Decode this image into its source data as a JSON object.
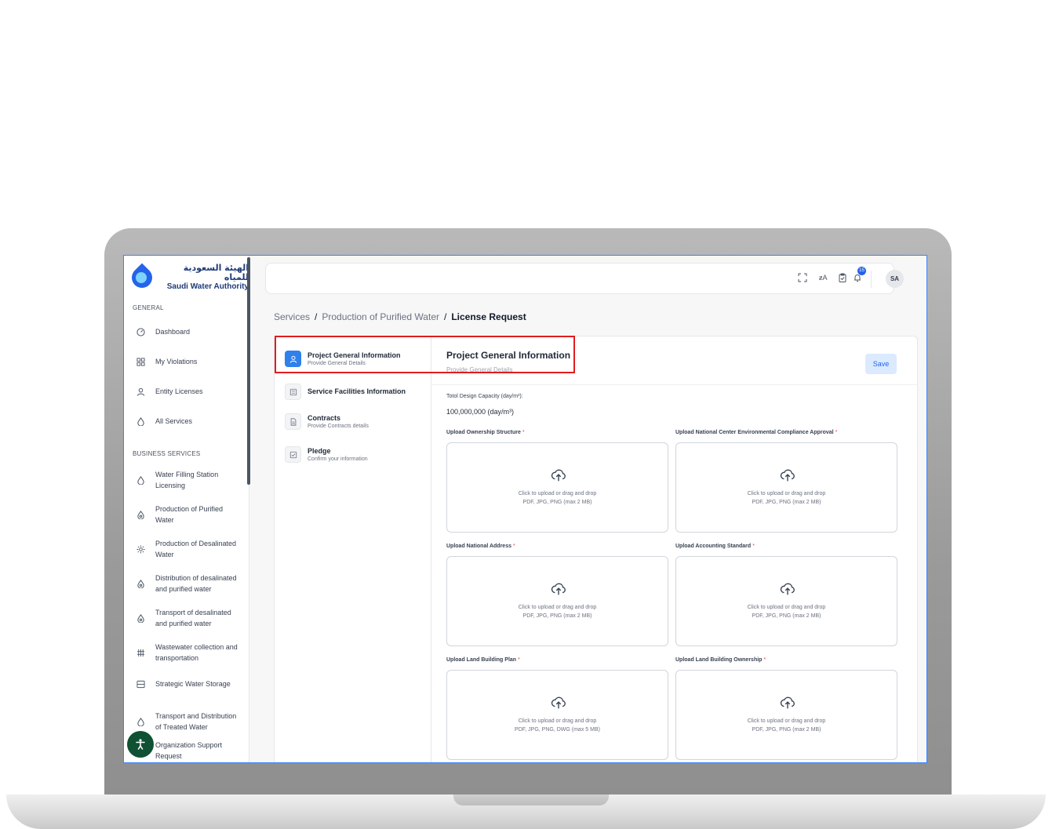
{
  "brand": {
    "arabic": "الهيئة السعودية للمياه",
    "english": "Saudi Water Authority"
  },
  "sidebar": {
    "general_heading": "GENERAL",
    "general_items": [
      {
        "label": "Dashboard",
        "icon": "dashboard-icon"
      },
      {
        "label": "My Violations",
        "icon": "grid-icon"
      },
      {
        "label": "Entity Licenses",
        "icon": "user-icon"
      },
      {
        "label": "All Services",
        "icon": "drop-icon"
      }
    ],
    "business_heading": "BUSINESS SERVICES",
    "business_items": [
      {
        "label": "Water Filling Station Licensing",
        "icon": "drop-icon"
      },
      {
        "label": "Production of Purified Water",
        "icon": "drop-icon"
      },
      {
        "label": "Production of Desalinated Water",
        "icon": "sun-icon"
      },
      {
        "label": "Distribution of desalinated and purified water",
        "icon": "drop-icon"
      },
      {
        "label": "Transport of desalinated and purified water",
        "icon": "drop-icon"
      },
      {
        "label": "Wastewater collection and transportation",
        "icon": "pipes-icon"
      },
      {
        "label": "Strategic Water Storage",
        "icon": "storage-icon"
      },
      {
        "label": "Transport and Distribution of Treated Water",
        "icon": "drop-icon"
      },
      {
        "label": "Organization Support Request",
        "icon": "support-icon"
      }
    ]
  },
  "topbar": {
    "avatar": "SA",
    "notification_count": "15"
  },
  "breadcrumb": {
    "item1": "Services",
    "item2": "Production of Purified Water",
    "current": "License Request",
    "separator": "/"
  },
  "steps": [
    {
      "title": "Project General Information",
      "subtitle": "Provide General Details"
    },
    {
      "title": "Service Facilities Information",
      "subtitle": ""
    },
    {
      "title": "Contracts",
      "subtitle": "Provide Contracts details"
    },
    {
      "title": "Pledge",
      "subtitle": "Confirm your information"
    }
  ],
  "form": {
    "title": "Project General Information",
    "subtitle": "Provide General Details",
    "save_label": "Save",
    "capacity_label": "Totol Design Capacity (day/m³):",
    "capacity_value": "100,000,000 (day/m³)",
    "uploads": [
      {
        "label": "Upload Ownership Structure",
        "hint1": "Click to upload or drag and drop",
        "hint2": "PDF, JPG, PNG (max 2 MB)"
      },
      {
        "label": "Upload National Center Environmental Compliance Approval",
        "hint1": "Click to upload or drag and drop",
        "hint2": "PDF, JPG, PNG (max 2 MB)"
      },
      {
        "label": "Upload National Address",
        "hint1": "Click to upload or drag and drop",
        "hint2": "PDF, JPG, PNG (max 2 MB)"
      },
      {
        "label": "Upload Accounting Standard",
        "hint1": "Click to upload or drag and drop",
        "hint2": "PDF, JPG, PNG (max 2 MB)"
      },
      {
        "label": "Upload Land Building Plan",
        "hint1": "Click to upload or drag and drop",
        "hint2": "PDF, JPG, PNG, DWG (max 5 MB)"
      },
      {
        "label": "Upload Land Building Ownership",
        "hint1": "Click to upload or drag and drop",
        "hint2": "PDF, JPG, PNG (max 2 MB)"
      }
    ],
    "required_mark": "*"
  },
  "colors": {
    "primary": "#2f80ed",
    "highlight": "#e11d1d",
    "accessibility": "#0f5132"
  }
}
